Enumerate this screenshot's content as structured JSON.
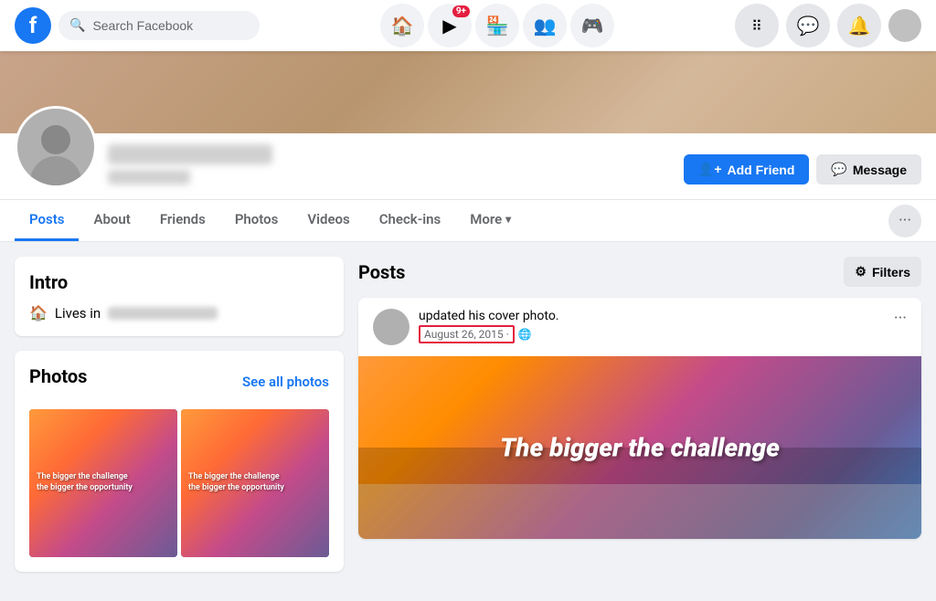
{
  "nav": {
    "logo_text": "f",
    "search_placeholder": "Search Facebook",
    "icons": {
      "home": "🏠",
      "video": "▶",
      "store": "🏪",
      "groups": "👥",
      "menu": "⋮⋮⋮",
      "messenger": "💬",
      "notifications": "🔔",
      "grid": "⠿"
    },
    "notification_badge": "9+",
    "add_friend_label": "Add Friend",
    "message_label": "Message"
  },
  "profile": {
    "name_placeholder": "blurred name",
    "sub_placeholder": "blurred sub"
  },
  "tabs": {
    "items": [
      {
        "id": "posts",
        "label": "Posts",
        "active": true
      },
      {
        "id": "about",
        "label": "About",
        "active": false
      },
      {
        "id": "friends",
        "label": "Friends",
        "active": false
      },
      {
        "id": "photos",
        "label": "Photos",
        "active": false
      },
      {
        "id": "videos",
        "label": "Videos",
        "active": false
      },
      {
        "id": "checkins",
        "label": "Check-ins",
        "active": false
      },
      {
        "id": "more",
        "label": "More",
        "active": false
      }
    ]
  },
  "intro": {
    "title": "Intro",
    "lives_in_label": "Lives in"
  },
  "photos": {
    "title": "Photos",
    "see_all_label": "See all photos",
    "items": [
      {
        "quote": "The bigger the challenge",
        "sub": "the bigger the opportunity"
      },
      {
        "quote": "The bigger the challenge",
        "sub": "the bigger the opportunity"
      }
    ]
  },
  "posts": {
    "title": "Posts",
    "filters_label": "Filters",
    "post": {
      "action_text": "updated his cover photo.",
      "date": "August 26, 2015 ·",
      "image_text": "The bigger the challenge"
    }
  }
}
